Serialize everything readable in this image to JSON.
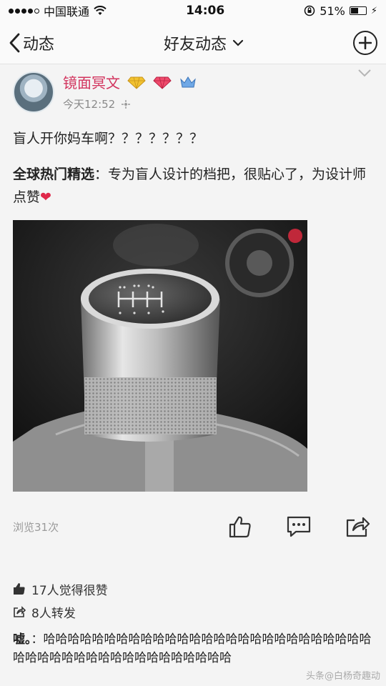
{
  "status_bar": {
    "carrier": "中国联通",
    "time": "14:06",
    "battery": "51%",
    "battery_level": 0.51
  },
  "nav": {
    "back_label": "动态",
    "title": "好友动态"
  },
  "post": {
    "username": "镜面冥文",
    "time": "今天12:52",
    "text1": "盲人开你妈车啊？？？？？？？",
    "text2_bold": "全球热门精选",
    "text2_rest": "：专为盲人设计的档把，很贴心了，为设计师点赞",
    "views": "浏览31次",
    "likes": "17人觉得很赞",
    "shares": "8人转发",
    "comment_author": "嘘。",
    "comment_text": "：哈哈哈哈哈哈哈哈哈哈哈哈哈哈哈哈哈哈哈哈哈哈哈哈哈哈哈哈哈哈哈哈哈哈哈哈哈哈哈哈哈哈哈哈哈"
  },
  "watermark": "头条@白杨奇趣动"
}
